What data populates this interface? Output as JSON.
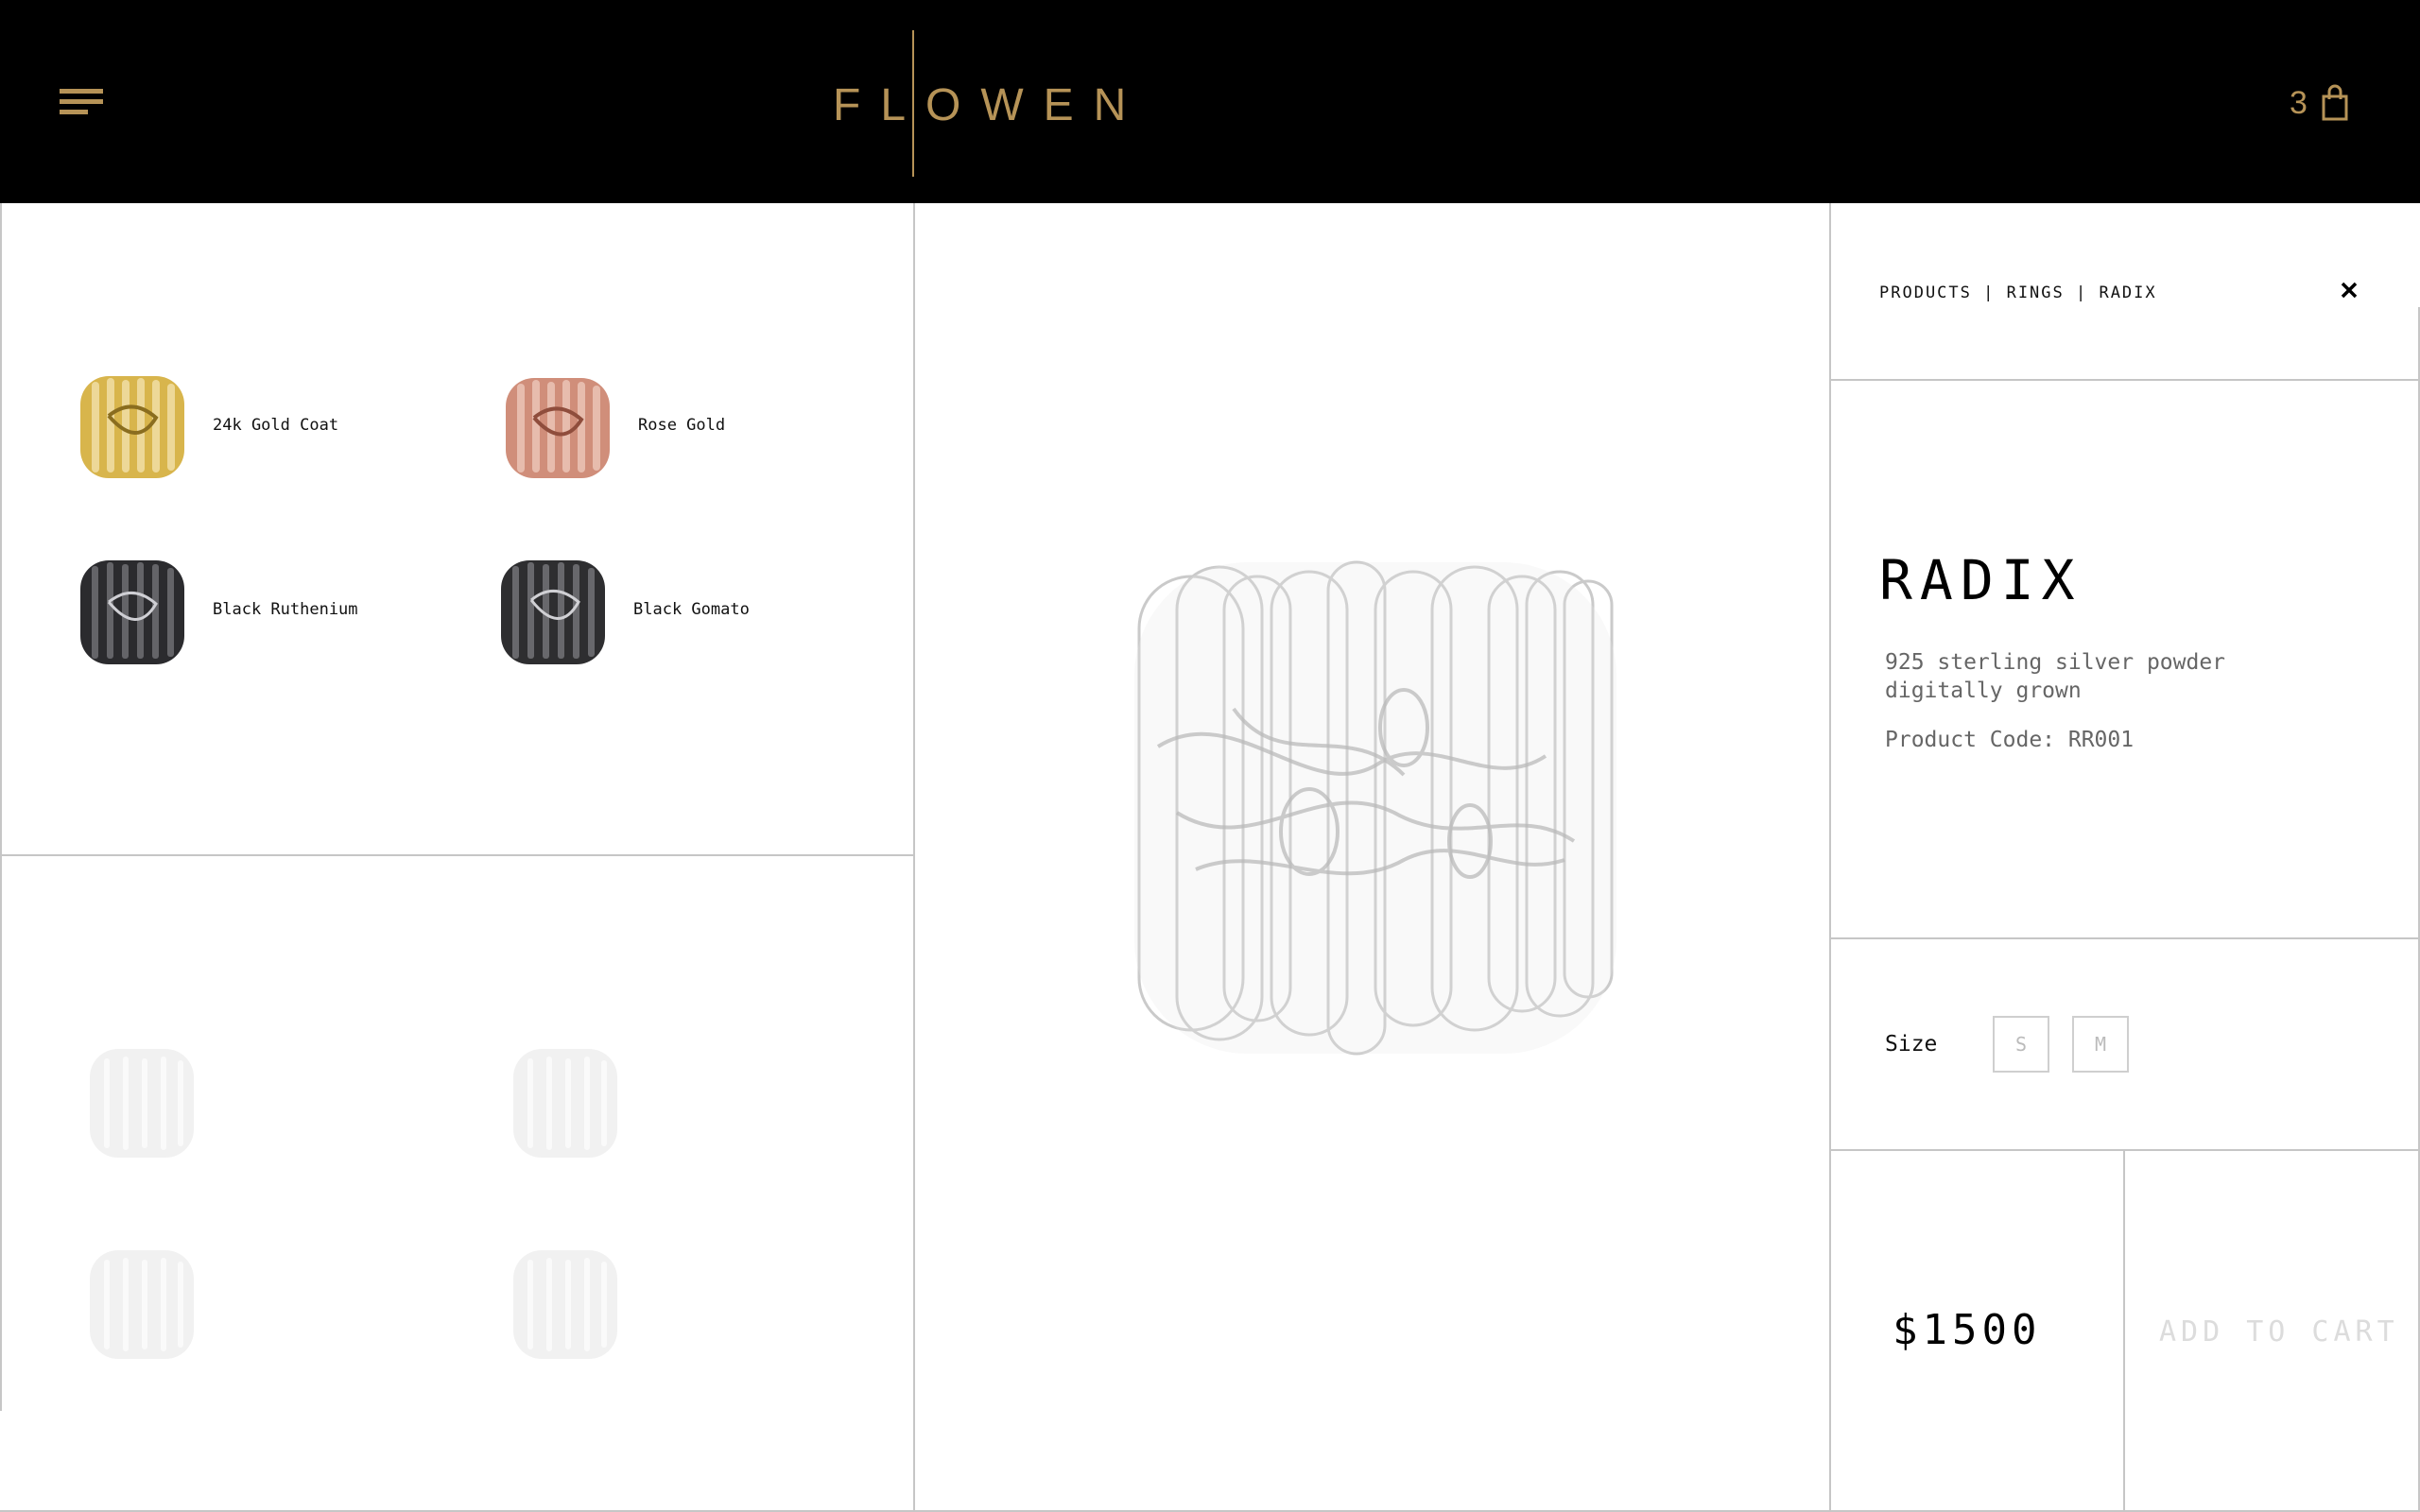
{
  "header": {
    "logo_text": "FLOWEN",
    "cart_count": "3",
    "menu_icon": "hamburger-menu-icon",
    "cart_icon": "shopping-bag-icon"
  },
  "colors": {
    "brand_gold": "#b69357",
    "header_bg": "#000000",
    "divider": "#c6c6c6",
    "muted_text": "#666666"
  },
  "variants": [
    {
      "label": "24k Gold Coat",
      "color": "#d8b54c"
    },
    {
      "label": "Rose Gold",
      "color": "#d08e7a"
    },
    {
      "label": "Black Ruthenium",
      "color": "#2b2b2e"
    },
    {
      "label": "Black Gomato",
      "color": "#2e2e30"
    }
  ],
  "product": {
    "breadcrumb": "PRODUCTS | RINGS | RADIX",
    "name": "RADIX",
    "description": "925 sterling silver powder digitally grown",
    "code": "Product Code: RR001",
    "size_label": "Size",
    "sizes": [
      "S",
      "M"
    ],
    "price": "$1500",
    "add_to_cart": "ADD TO CART"
  }
}
